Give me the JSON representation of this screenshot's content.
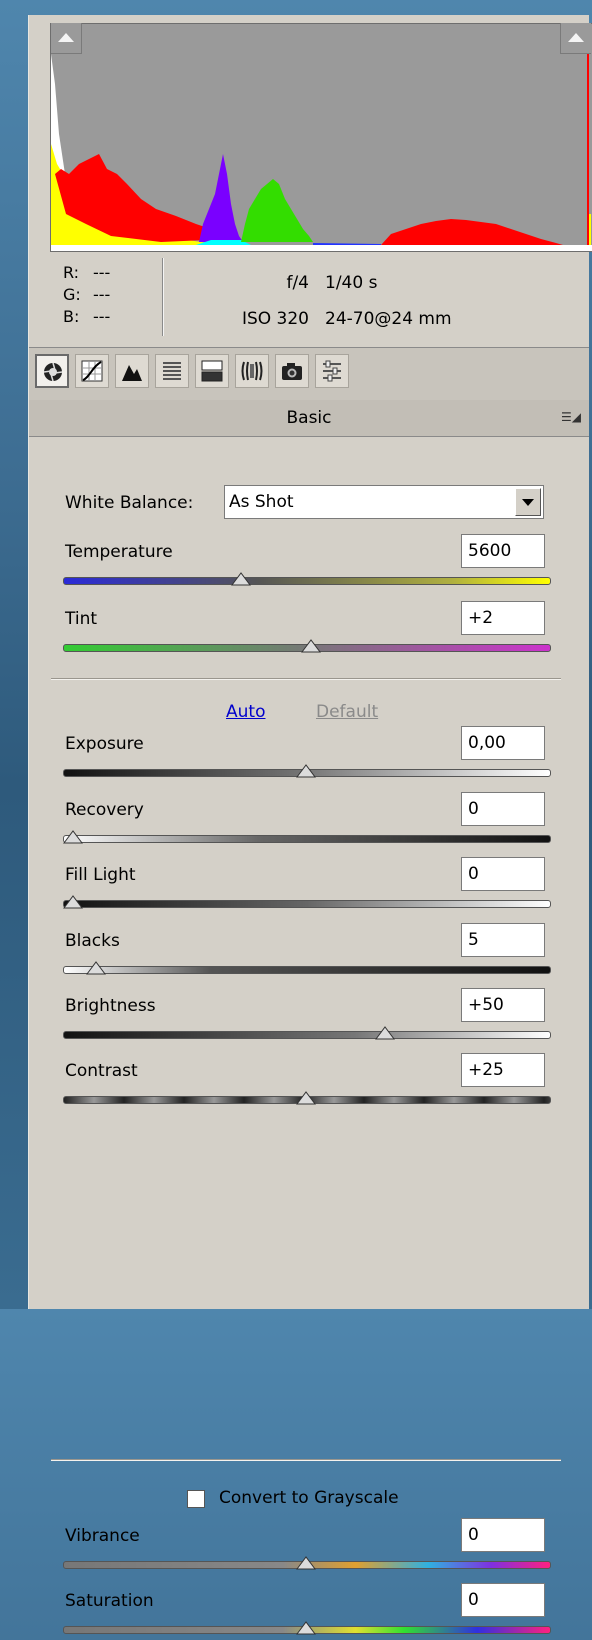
{
  "histogram": {
    "shadow_clip_icon": "triangle-up-icon",
    "highlight_clip_icon": "triangle-up-icon"
  },
  "info": {
    "r_label": "R:",
    "r_value": "---",
    "g_label": "G:",
    "g_value": "---",
    "b_label": "B:",
    "b_value": "---",
    "aperture": "f/4",
    "shutter": "1/40 s",
    "iso": "ISO 320",
    "lens": "24-70@24 mm"
  },
  "toolbar": {
    "tools": [
      "basic-icon",
      "tone-curve-icon",
      "detail-icon",
      "hsl-icon",
      "split-toning-icon",
      "lens-corrections-icon",
      "camera-calibration-icon",
      "presets-icon"
    ],
    "active_tool": "basic-icon"
  },
  "section": {
    "title": "Basic",
    "menu_icon": "panel-menu-icon"
  },
  "white_balance": {
    "label": "White Balance:",
    "value": "As Shot"
  },
  "sliders_wb": [
    {
      "label": "Temperature",
      "value": "5600",
      "level": 0.36
    },
    {
      "label": "Tint",
      "value": "+2",
      "level": 0.51
    }
  ],
  "auto_label": "Auto",
  "default_label": "Default",
  "sliders_tone": [
    {
      "label": "Exposure",
      "value": "0,00",
      "level": 0.5
    },
    {
      "label": "Recovery",
      "value": "0",
      "level": 0.0
    },
    {
      "label": "Fill Light",
      "value": "0",
      "level": 0.0
    },
    {
      "label": "Blacks",
      "value": "5",
      "level": 0.05
    },
    {
      "label": "Brightness",
      "value": "+50",
      "level": 0.67
    },
    {
      "label": "Contrast",
      "value": "+25",
      "level": 0.5
    }
  ],
  "grayscale": {
    "label": "Convert to Grayscale",
    "checked": false
  },
  "sliders_presence": [
    {
      "label": "Vibrance",
      "value": "0",
      "level": 0.5
    },
    {
      "label": "Saturation",
      "value": "0",
      "level": 0.5
    }
  ],
  "colors": {
    "histogram_bg": "#9a9a9a",
    "panel_bg": "#d4d0c8",
    "link": "#0000cc"
  }
}
